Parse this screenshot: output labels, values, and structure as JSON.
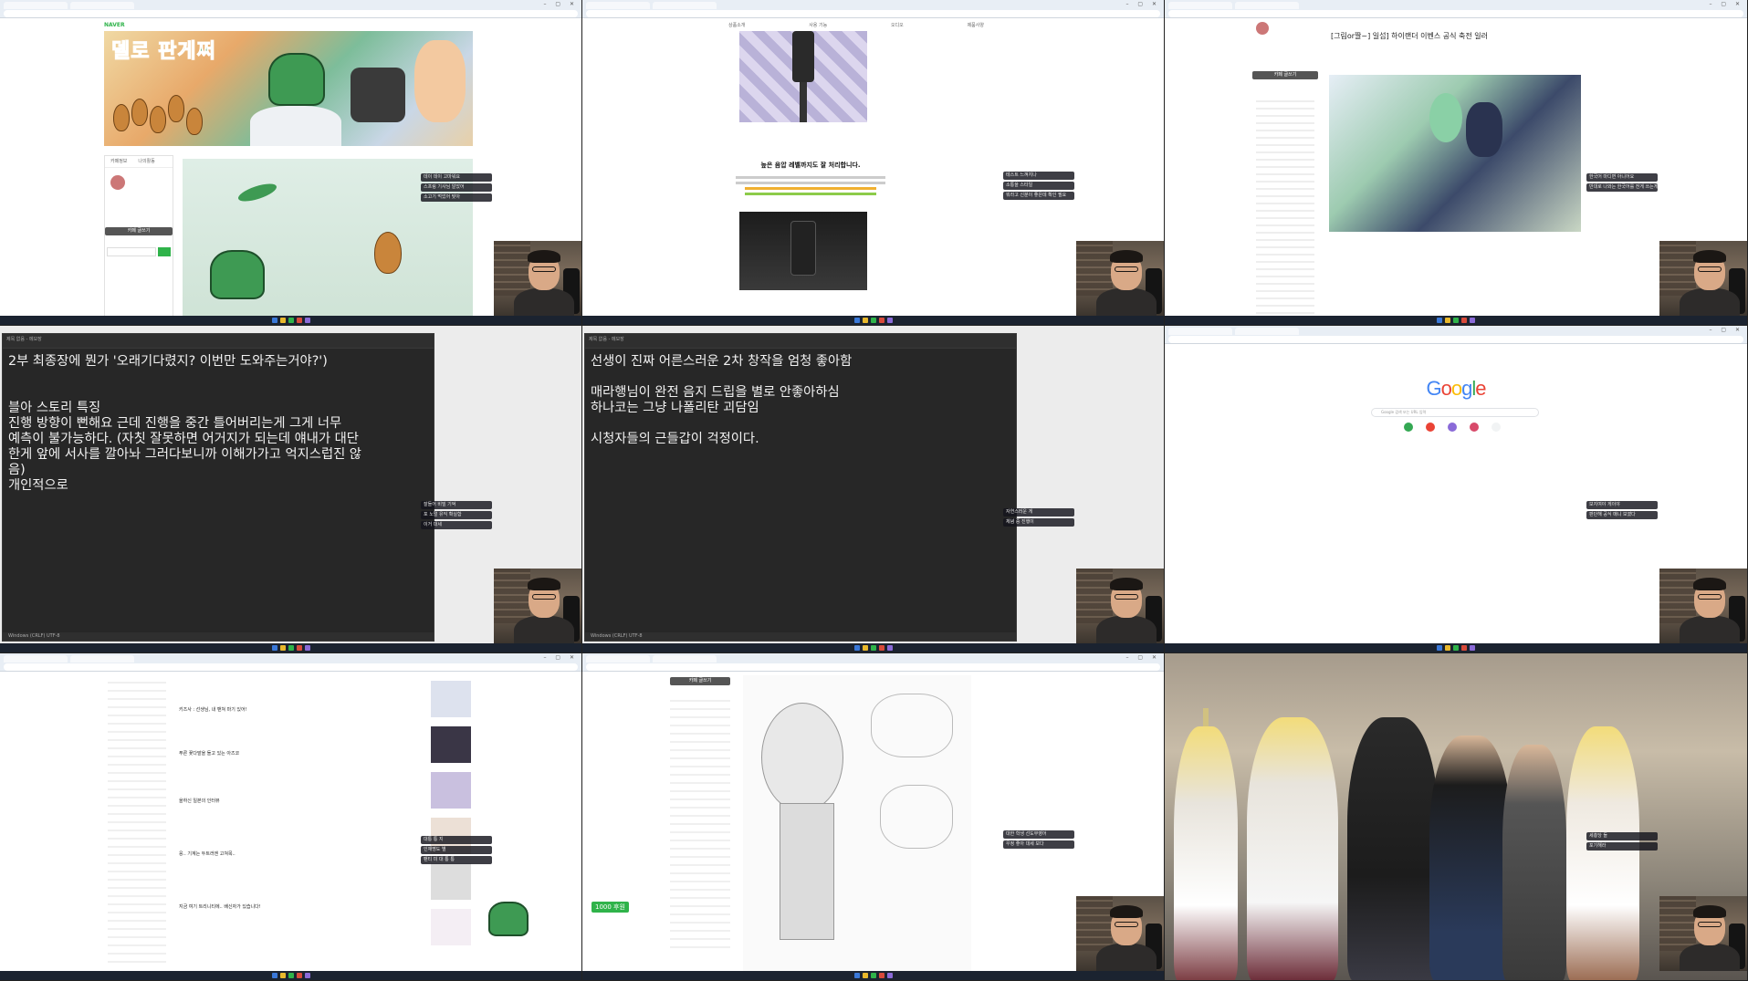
{
  "colors": {
    "accent_green": "#2fb34a",
    "notepad_bg": "#272727",
    "taskbar": "#1b2330"
  },
  "panel1": {
    "site_logo": "NAVER",
    "banner_title": "델로 판게쩌",
    "tab_cafe_info": "카페정보",
    "tab_my_activity": "나의활동",
    "write_button": "카페 글쓰기",
    "chat": [
      "데이 데이 고마워요",
      "스프링 기사님 알았어",
      "소고기 먹었어 맞아"
    ]
  },
  "panel2": {
    "nav_items": [
      "상품소개",
      "사용 기능",
      "오디오",
      "제품사양"
    ],
    "heading": "높은 음압 레벨까지도 잘 처리합니다.",
    "chat": [
      "테스트 느껴지나",
      "소통을 스타일",
      "뭐라고 신분이 좋은데 확인 필요"
    ]
  },
  "panel3": {
    "post_title": "[그림or짤~] 일섭] 하이랜더 이벤스 공식 축전 일러",
    "write_button": "카페 글쓰기",
    "chat": [
      "한국어 마디면 아니어요",
      "반대로 나와는 한국어를 전게 쓰는게 어떨까"
    ]
  },
  "panel4": {
    "notepad_text": "2부 최종장에 뭔가 '오래기다렸지? 이번만 도와주는거야?')\n\n\n블아 스토리 특징\n진행 방향이 뻔해요 근데 진행을 중간 틀어버리는게 그게 너무\n예측이 불가능하다. (자칫 잘못하면 어거지가 되는데 얘내가 대단\n한게 앞에 서사를 깔아놔 그러다보니까 이해가가고 억지스럽진 않\n음)\n개인적으로 ",
    "tab_title": "제목 없음 - 메모장",
    "status": "Windows (CRLF)   UTF-8",
    "chat": [
      "잘들어 비밀 기억",
      "포 노멀 유익 확실함",
      "이거 대세"
    ]
  },
  "panel5": {
    "notepad_text": "선생이 진짜 어른스러운 2차 창작을 엄청 좋아함\n\n매라행님이 완전 음지 드립을 별로 안좋아하심\n하나코는 그냥 나폴리탄 괴담임\n\n시청자들의 근들갑이 걱정이다.",
    "tab_title": "제목 없음 - 메모장",
    "status": "Windows (CRLF)   UTF-8",
    "chat": [
      "자연스러운 게",
      "체념 중 진행이"
    ]
  },
  "panel6": {
    "google_logo": "Google",
    "search_placeholder": "Google 검색 또는 URL 입력",
    "shortcuts": [
      "",
      "",
      "",
      "",
      ""
    ],
    "chat": [
      "보지여야 게이야",
      "판단해 공식 매니 보였다"
    ]
  },
  "panel7": {
    "posts": [
      "키즈사 : 선생님, 내 밴쳐 마기 있어!",
      "푸른 꽃다발을 들고 있는 아즈코",
      "을하신 일본의 인터뷰",
      "응.. 기계는 두트러엔 고쳐목..",
      "지금 여기 트리니티에.. 배신자가 있습니다!"
    ],
    "chat": [
      "대통 통 지",
      "인재명도 별",
      "팬티 미 대 통 통"
    ]
  },
  "panel8": {
    "write_button": "카페 글쓰기",
    "donation": "1000 후원",
    "chat": [
      "대한 학생 선도부영어",
      "우정 좋아 대세 보다"
    ]
  },
  "panel9": {
    "chat": [
      "세총당 들",
      "포기해라"
    ]
  }
}
